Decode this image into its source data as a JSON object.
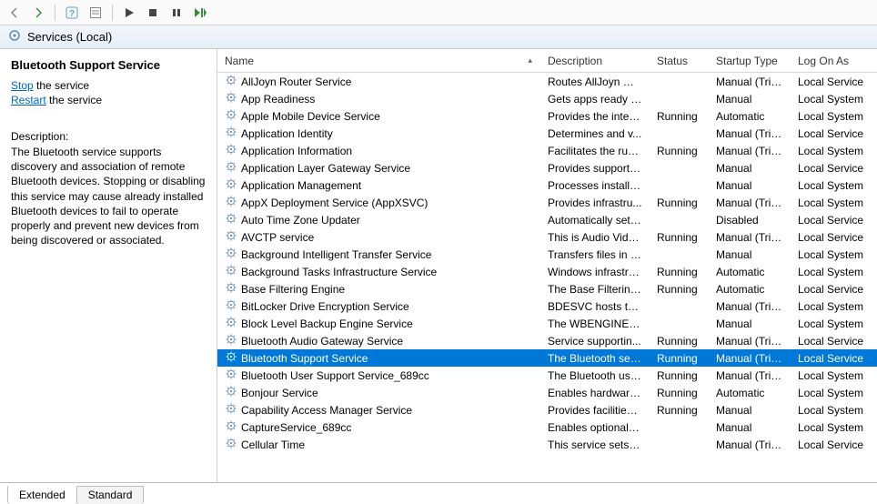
{
  "header": {
    "title": "Services (Local)"
  },
  "detail": {
    "title": "Bluetooth Support Service",
    "stop_link": "Stop",
    "stop_rest": " the service",
    "restart_link": "Restart",
    "restart_rest": " the service",
    "desc_label": "Description:",
    "desc_text": "The Bluetooth service supports discovery and association of remote Bluetooth devices.  Stopping or disabling this service may cause already installed Bluetooth devices to fail to operate properly and prevent new devices from being discovered or associated."
  },
  "columns": {
    "name": "Name",
    "desc": "Description",
    "status": "Status",
    "stype": "Startup Type",
    "logon": "Log On As"
  },
  "tabs": {
    "extended": "Extended",
    "standard": "Standard"
  },
  "services": [
    {
      "name": "AllJoyn Router Service",
      "desc": "Routes AllJoyn me...",
      "status": "",
      "stype": "Manual (Trig...",
      "logon": "Local Service"
    },
    {
      "name": "App Readiness",
      "desc": "Gets apps ready fo...",
      "status": "",
      "stype": "Manual",
      "logon": "Local System"
    },
    {
      "name": "Apple Mobile Device Service",
      "desc": "Provides the interf...",
      "status": "Running",
      "stype": "Automatic",
      "logon": "Local System"
    },
    {
      "name": "Application Identity",
      "desc": "Determines and v...",
      "status": "",
      "stype": "Manual (Trig...",
      "logon": "Local Service"
    },
    {
      "name": "Application Information",
      "desc": "Facilitates the run...",
      "status": "Running",
      "stype": "Manual (Trig...",
      "logon": "Local System"
    },
    {
      "name": "Application Layer Gateway Service",
      "desc": "Provides support f...",
      "status": "",
      "stype": "Manual",
      "logon": "Local Service"
    },
    {
      "name": "Application Management",
      "desc": "Processes installat...",
      "status": "",
      "stype": "Manual",
      "logon": "Local System"
    },
    {
      "name": "AppX Deployment Service (AppXSVC)",
      "desc": "Provides infrastru...",
      "status": "Running",
      "stype": "Manual (Trig...",
      "logon": "Local System"
    },
    {
      "name": "Auto Time Zone Updater",
      "desc": "Automatically sets...",
      "status": "",
      "stype": "Disabled",
      "logon": "Local Service"
    },
    {
      "name": "AVCTP service",
      "desc": "This is Audio Vide...",
      "status": "Running",
      "stype": "Manual (Trig...",
      "logon": "Local Service"
    },
    {
      "name": "Background Intelligent Transfer Service",
      "desc": "Transfers files in th...",
      "status": "",
      "stype": "Manual",
      "logon": "Local System"
    },
    {
      "name": "Background Tasks Infrastructure Service",
      "desc": "Windows infrastru...",
      "status": "Running",
      "stype": "Automatic",
      "logon": "Local System"
    },
    {
      "name": "Base Filtering Engine",
      "desc": "The Base Filtering ...",
      "status": "Running",
      "stype": "Automatic",
      "logon": "Local Service"
    },
    {
      "name": "BitLocker Drive Encryption Service",
      "desc": "BDESVC hosts the ...",
      "status": "",
      "stype": "Manual (Trig...",
      "logon": "Local System"
    },
    {
      "name": "Block Level Backup Engine Service",
      "desc": "The WBENGINE se...",
      "status": "",
      "stype": "Manual",
      "logon": "Local System"
    },
    {
      "name": "Bluetooth Audio Gateway Service",
      "desc": "Service supportin...",
      "status": "Running",
      "stype": "Manual (Trig...",
      "logon": "Local Service"
    },
    {
      "name": "Bluetooth Support Service",
      "desc": "The Bluetooth ser...",
      "status": "Running",
      "stype": "Manual (Trig...",
      "logon": "Local Service",
      "selected": true
    },
    {
      "name": "Bluetooth User Support Service_689cc",
      "desc": "The Bluetooth use...",
      "status": "Running",
      "stype": "Manual (Trig...",
      "logon": "Local System"
    },
    {
      "name": "Bonjour Service",
      "desc": "Enables hardware ...",
      "status": "Running",
      "stype": "Automatic",
      "logon": "Local System"
    },
    {
      "name": "Capability Access Manager Service",
      "desc": "Provides facilities ...",
      "status": "Running",
      "stype": "Manual",
      "logon": "Local System"
    },
    {
      "name": "CaptureService_689cc",
      "desc": "Enables optional s...",
      "status": "",
      "stype": "Manual",
      "logon": "Local System"
    },
    {
      "name": "Cellular Time",
      "desc": "This service sets ti...",
      "status": "",
      "stype": "Manual (Trig...",
      "logon": "Local Service"
    }
  ]
}
